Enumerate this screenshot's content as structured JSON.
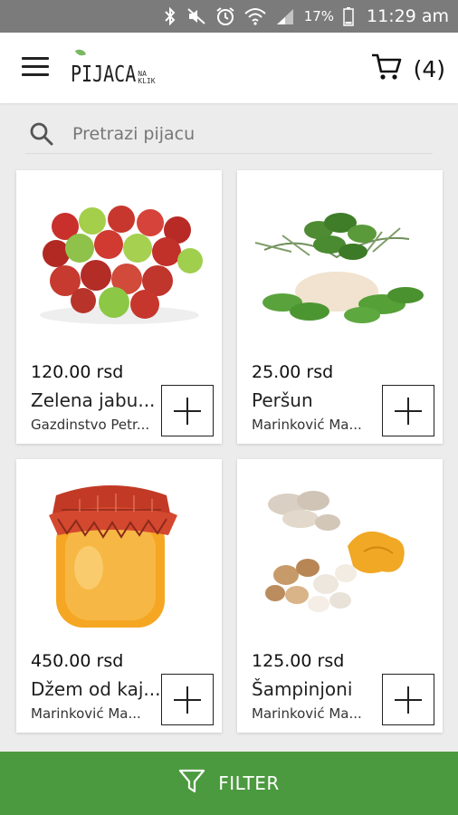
{
  "status_bar": {
    "battery": "17%",
    "time": "11:29 am",
    "icons": [
      "bluetooth-icon",
      "mute-icon",
      "alarm-icon",
      "wifi-icon",
      "signal-icon",
      "battery-icon"
    ]
  },
  "app_bar": {
    "logo_main": "PIJACA",
    "logo_small_top": "NA",
    "logo_small_bottom": "KLIK",
    "cart_count": "(4)",
    "menu_icon": "menu-icon",
    "cart_icon": "cart-icon"
  },
  "search": {
    "placeholder": "Pretrazi pijacu",
    "value": "",
    "icon": "search-icon"
  },
  "products": [
    {
      "price": "120.00 rsd",
      "name": "Zelena jabu...",
      "seller": "Gazdinstvo Petr...",
      "image": "apples"
    },
    {
      "price": "25.00 rsd",
      "name": "Peršun",
      "seller": "Marinković Ma...",
      "image": "parsley"
    },
    {
      "price": "450.00 rsd",
      "name": "Džem od kaj...",
      "seller": "Marinković Ma...",
      "image": "jam-jar"
    },
    {
      "price": "125.00 rsd",
      "name": "Šampinjoni",
      "seller": "Marinković Ma...",
      "image": "mushrooms"
    }
  ],
  "filter_bar": {
    "label": "FILTER",
    "icon": "filter-icon"
  },
  "colors": {
    "accent_green": "#4c9a3f",
    "status_bar": "#7b7b7b",
    "background": "#ececec"
  }
}
